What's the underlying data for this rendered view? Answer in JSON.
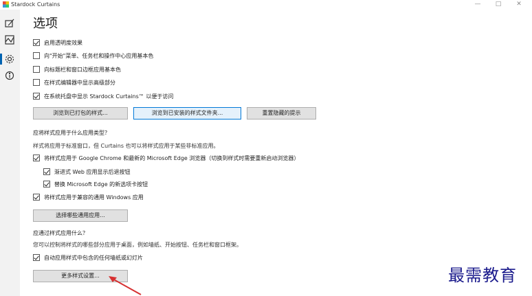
{
  "window": {
    "title": "Stardock Curtains",
    "minimize": "—",
    "maximize": "□",
    "close": "✕"
  },
  "sidebar": {
    "items": [
      {
        "icon": "paint-brush-icon"
      },
      {
        "icon": "image-frame-icon"
      },
      {
        "icon": "gear-icon",
        "active": true
      },
      {
        "icon": "info-icon"
      }
    ]
  },
  "page": {
    "title": "选项"
  },
  "options": [
    {
      "label": "启用透明度效果",
      "checked": true
    },
    {
      "label": "向\"开始\"菜单、任务栏和操作中心应用基本色",
      "checked": false
    },
    {
      "label": "向标题栏和窗口边框应用基本色",
      "checked": false
    },
    {
      "label": "在样式编辑器中显示高级部分",
      "checked": false
    },
    {
      "label": "在系统托盘中显示 Stardock Curtains™ 以便于访问",
      "checked": true
    }
  ],
  "buttons": {
    "browse_packaged": "浏览到已打包的样式...",
    "browse_installed": "浏览到已安装的样式文件夹...",
    "reset_hidden": "重置隐藏的提示",
    "select_apps": "选择哪些通用应用...",
    "more_styles": "更多样式设置..."
  },
  "app_types": {
    "heading": "应将样式应用于什么应用类型？",
    "description": "样式将应用于标准窗口，但 Curtains 也可以将样式应用于某些非标准应用。",
    "options": [
      {
        "label": "将样式应用于 Google Chrome 和最新的 Microsoft Edge 浏览器（切换到样式时需要重新启动浏览器）",
        "checked": true
      },
      {
        "label": "渐进式 Web 应用显示后退按钮",
        "checked": true
      },
      {
        "label": "替换 Microsoft Edge 的新选项卡按钮",
        "checked": true
      },
      {
        "label": "将样式应用于兼容的通用 Windows 应用",
        "checked": true
      }
    ]
  },
  "apply_what": {
    "heading": "应通过样式应用什么？",
    "description": "您可以控制将样式的哪些部分应用于桌面，例如墙纸、开始按钮、任务栏和窗口框架。",
    "options": [
      {
        "label": "自动应用样式中包含的任何墙纸或幻灯片",
        "checked": true
      }
    ]
  },
  "watermark": "最需教育"
}
